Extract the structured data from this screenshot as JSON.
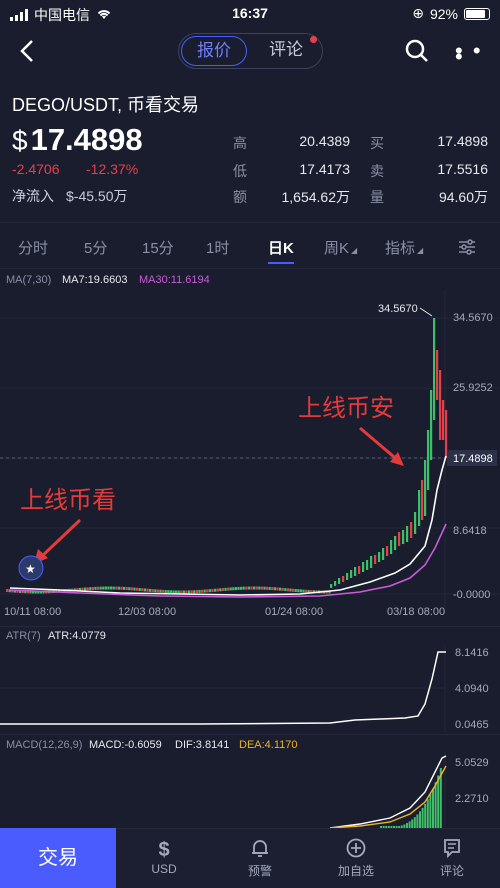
{
  "status": {
    "carrier": "中国电信",
    "time": "16:37",
    "battery": "92%"
  },
  "nav": {
    "tab_quote": "报价",
    "tab_comment": "评论"
  },
  "header": {
    "pair": "DEGO/USDT, 币看交易",
    "currency": "$",
    "price": "17.4898",
    "change_abs": "-2.4706",
    "change_pct": "-12.37%",
    "netflow_label": "净流入",
    "netflow_value": "$-45.50万",
    "stats": [
      {
        "k": "高",
        "v": "20.4389"
      },
      {
        "k": "低",
        "v": "17.4173"
      },
      {
        "k": "额",
        "v": "1,654.62万"
      },
      {
        "k": "买",
        "v": "17.4898"
      },
      {
        "k": "卖",
        "v": "17.5516"
      },
      {
        "k": "量",
        "v": "94.60万"
      }
    ]
  },
  "tabs": [
    "分时",
    "5分",
    "15分",
    "1时",
    "日K",
    "周K",
    "指标"
  ],
  "indicators": {
    "ma_label": "MA(7,30)",
    "ma7": "MA7:19.6603",
    "ma30": "MA30:11.6194",
    "atr_label": "ATR(7)",
    "atr_value": "ATR:4.0779",
    "macd_label": "MACD(12,26,9)",
    "macd_value": "MACD:-0.6059",
    "dif_value": "DIF:3.8141",
    "dea_value": "DEA:4.1170"
  },
  "main_chart": {
    "y_ticks": [
      "34.5670",
      "25.9252",
      "17.4898",
      "8.6418",
      "-0.0000"
    ],
    "x_ticks": [
      "10/11 08:00",
      "12/03 08:00",
      "01/24 08:00",
      "03/18 08:00"
    ],
    "high_label": "34.5670",
    "current_label": "17.4898",
    "annotation_binance": "上线币安",
    "annotation_bikan": "上线币看"
  },
  "atr_chart": {
    "y_ticks": [
      "8.1416",
      "4.0940",
      "0.0465"
    ]
  },
  "macd_chart": {
    "y_ticks": [
      "5.0529",
      "2.2710"
    ]
  },
  "colors": {
    "up": "#3fbf6a",
    "down": "#e5404a",
    "accent": "#4b5cff",
    "ma7": "#ffffff",
    "ma30": "#c95bd8",
    "dea": "#f0b429"
  },
  "bottom": {
    "trade": "交易",
    "items": [
      {
        "label": "USD",
        "icon": "dollar-icon"
      },
      {
        "label": "预警",
        "icon": "bell-icon"
      },
      {
        "label": "加自选",
        "icon": "add-circle-icon"
      },
      {
        "label": "评论",
        "icon": "comment-icon"
      }
    ]
  }
}
